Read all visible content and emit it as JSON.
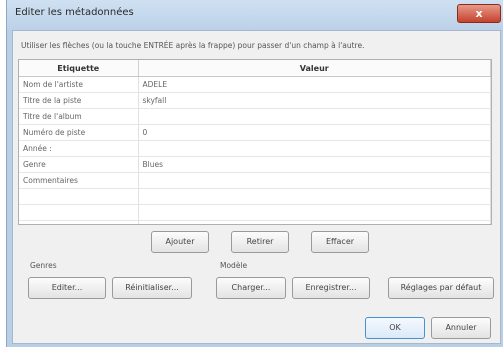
{
  "window": {
    "title": "Editer les métadonnées",
    "close_label": "x"
  },
  "instruction": "Utiliser les flèches (ou la touche ENTRÉE après la frappe) pour passer d'un champ à l'autre.",
  "table": {
    "headers": [
      "Etiquette",
      "Valeur"
    ],
    "rows": [
      [
        "Nom de l'artiste",
        "ADELE"
      ],
      [
        "Titre de la piste",
        "skyfall"
      ],
      [
        "Titre de l'album",
        ""
      ],
      [
        "Numéro de piste",
        "0"
      ],
      [
        "Année :",
        ""
      ],
      [
        "Genre",
        "Blues"
      ],
      [
        "Commentaires",
        ""
      ],
      [
        "",
        ""
      ],
      [
        "",
        ""
      ],
      [
        "",
        ""
      ]
    ]
  },
  "row_buttons": {
    "add": "Ajouter",
    "remove": "Retirer",
    "clear": "Effacer"
  },
  "genres": {
    "label": "Genres",
    "edit": "Editer...",
    "reset": "Réinitialiser..."
  },
  "model": {
    "label": "Modèle",
    "load": "Charger...",
    "save": "Enregistrer...",
    "defaults": "Réglages par défaut"
  },
  "dialog_buttons": {
    "ok": "OK",
    "cancel": "Annuler"
  }
}
